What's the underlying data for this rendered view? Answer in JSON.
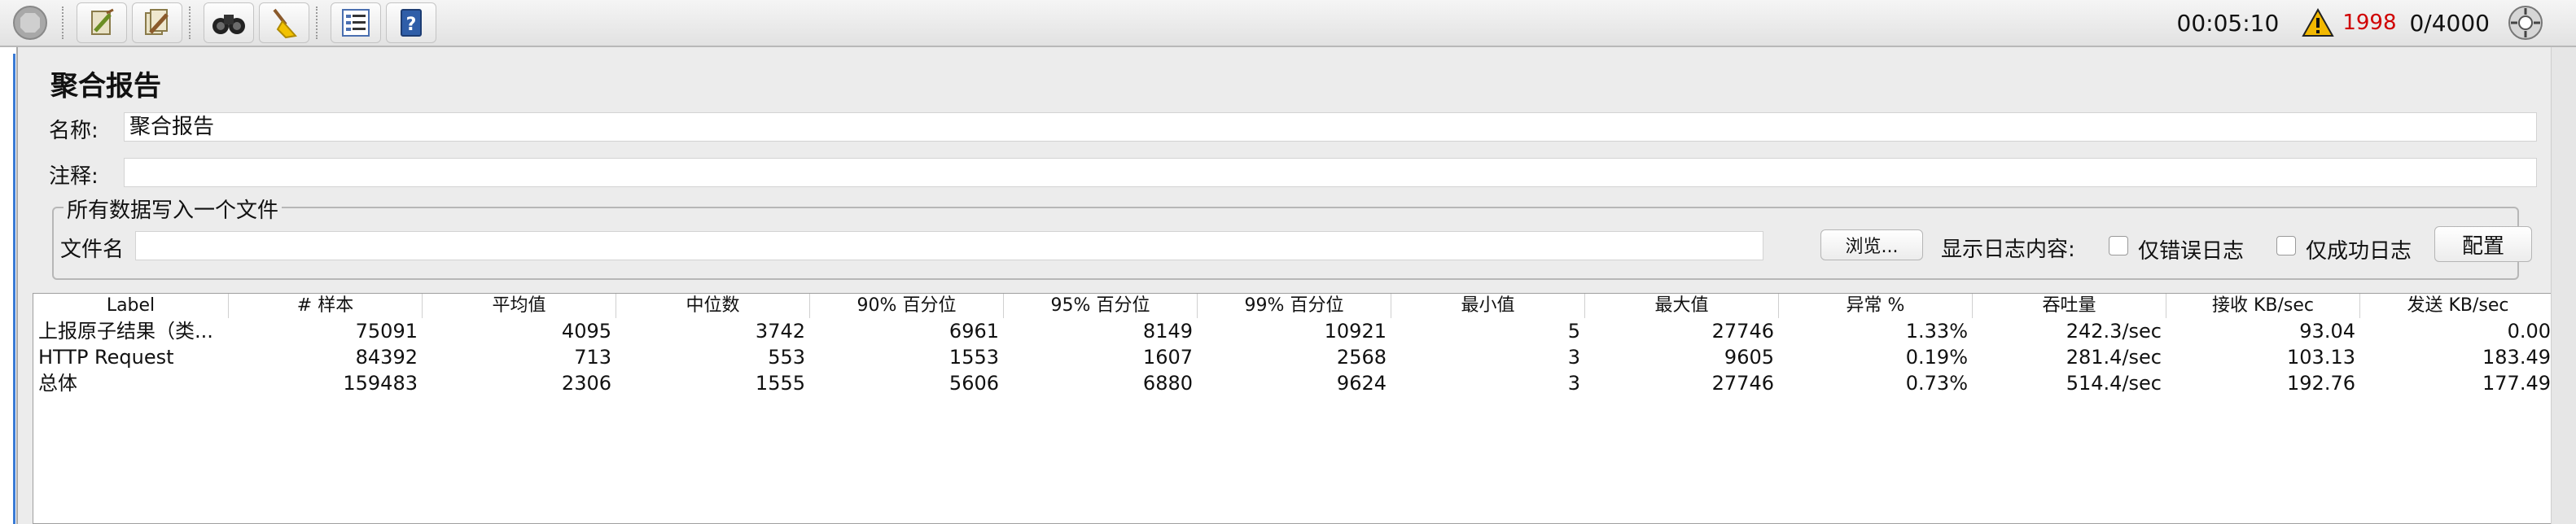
{
  "toolbar": {
    "buttons": [
      {
        "icon": "stop-icon"
      },
      {
        "icon": "clear-icon"
      },
      {
        "icon": "clear-all-icon"
      },
      {
        "icon": "search-binoculars-icon"
      },
      {
        "icon": "broom-icon"
      },
      {
        "icon": "function-list-icon"
      },
      {
        "icon": "help-book-icon"
      }
    ],
    "timer": "00:05:10",
    "error_count": "1998",
    "threads": "0/4000",
    "warning_color": "#f2b800",
    "error_color": "#d00000"
  },
  "page": {
    "title": "聚合报告",
    "name_label": "名称:",
    "name_value": "聚合报告",
    "comment_label": "注释:",
    "comment_value": ""
  },
  "file_group": {
    "legend": "所有数据写入一个文件",
    "file_label": "文件名",
    "file_value": "",
    "browse_button": "浏览...",
    "log_content_label": "显示日志内容:",
    "errors_only_label": "仅错误日志",
    "success_only_label": "仅成功日志",
    "config_button": "配置"
  },
  "table": {
    "columns": [
      "Label",
      "# 样本",
      "平均值",
      "中位数",
      "90% 百分位",
      "95% 百分位",
      "99% 百分位",
      "最小值",
      "最大值",
      "异常 %",
      "吞吐量",
      "接收 KB/sec",
      "发送 KB/sec"
    ],
    "rows": [
      [
        "上报原子结果（类...",
        "75091",
        "4095",
        "3742",
        "6961",
        "8149",
        "10921",
        "5",
        "27746",
        "1.33%",
        "242.3/sec",
        "93.04",
        "0.00"
      ],
      [
        "HTTP Request",
        "84392",
        "713",
        "553",
        "1553",
        "1607",
        "2568",
        "3",
        "9605",
        "0.19%",
        "281.4/sec",
        "103.13",
        "183.49"
      ],
      [
        "总体",
        "159483",
        "2306",
        "1555",
        "5606",
        "6880",
        "9624",
        "3",
        "27746",
        "0.73%",
        "514.4/sec",
        "192.76",
        "177.49"
      ]
    ]
  }
}
